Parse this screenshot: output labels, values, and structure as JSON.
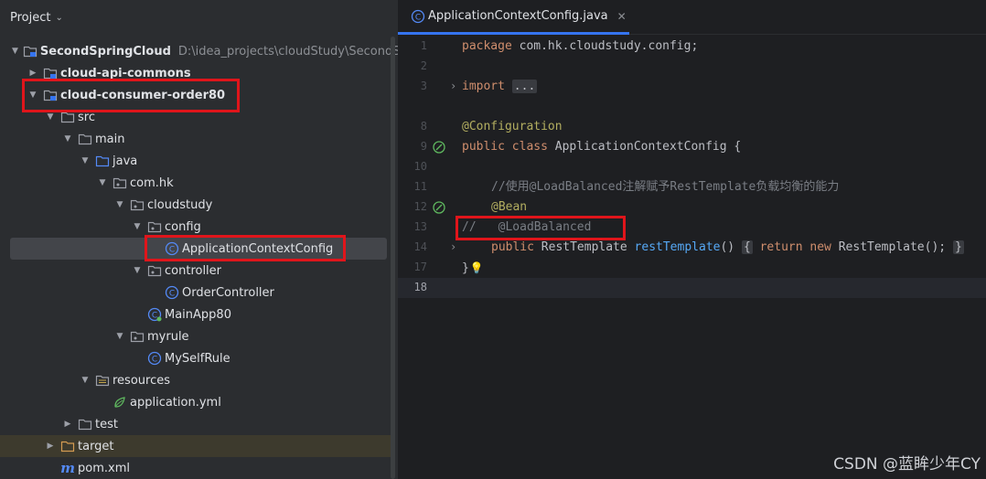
{
  "project_panel": {
    "title": "Project",
    "items": [
      {
        "label": "SecondSpringCloud",
        "sub": "D:\\idea_projects\\cloudStudy\\SecondSpri"
      },
      {
        "label": "cloud-api-commons"
      },
      {
        "label": "cloud-consumer-order80"
      },
      {
        "label": "src"
      },
      {
        "label": "main"
      },
      {
        "label": "java"
      },
      {
        "label": "com.hk"
      },
      {
        "label": "cloudstudy"
      },
      {
        "label": "config"
      },
      {
        "label": "ApplicationContextConfig"
      },
      {
        "label": "controller"
      },
      {
        "label": "OrderController"
      },
      {
        "label": "MainApp80"
      },
      {
        "label": "myrule"
      },
      {
        "label": "MySelfRule"
      },
      {
        "label": "resources"
      },
      {
        "label": "application.yml"
      },
      {
        "label": "test"
      },
      {
        "label": "target"
      },
      {
        "label": "pom.xml"
      }
    ]
  },
  "editor": {
    "tab_label": "ApplicationContextConfig.java",
    "line_numbers": [
      "1",
      "2",
      "3",
      "8",
      "9",
      "10",
      "11",
      "12",
      "13",
      "14",
      "17",
      "18"
    ],
    "code": {
      "l1_kw": "package",
      "l1_rest": " com.hk.cloudstudy.config;",
      "l3_kw": "import",
      "l3_fold": "...",
      "l8_ann": "@Configuration",
      "l9_kw": "public class",
      "l9_rest": " ApplicationContextConfig {",
      "l11_comment": "//使用@LoadBalanced注解赋予RestTemplate负载均衡的能力",
      "l12_ann": "@Bean",
      "l13_comment_mark": "//",
      "l13_comment_text": "@LoadBalanced",
      "l14_kw": "public",
      "l14_type": " RestTemplate ",
      "l14_fn": "restTemplate",
      "l14_parens": "()",
      "l14_open": "{",
      "l14_kw2": "return new",
      "l14_body": " RestTemplate();",
      "l14_close": "}",
      "l17": "}"
    }
  },
  "watermark": "CSDN @蓝眸少年CY",
  "colors": {
    "highlight_box": "#e0151b",
    "tab_underline": "#3574f0"
  }
}
